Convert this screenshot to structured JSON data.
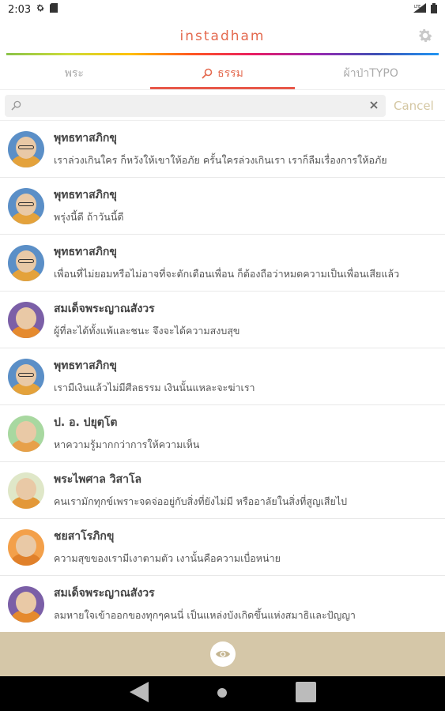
{
  "status_bar": {
    "time": "2:03",
    "network": "LTE"
  },
  "header": {
    "title": "instadham"
  },
  "tabs": [
    {
      "label": "พระ",
      "active": false
    },
    {
      "label": "ธรรม",
      "active": true
    },
    {
      "label": "ผ้าป่าTYPO",
      "active": false
    }
  ],
  "search": {
    "value": "",
    "placeholder": "",
    "cancel_label": "Cancel"
  },
  "colors": {
    "accent": "#e46a4f",
    "bottom_bar": "#d5c7a8",
    "cancel": "#d4c7a3"
  },
  "list": [
    {
      "name": "พุทธทาสภิกขุ",
      "quote": "เราล่วงเกินใคร ก็หวังให้เขาให้อภัย ครั้นใครล่วงเกินเรา เราก็ลืมเรื่องการให้อภัย",
      "avatar": "buddhadasa"
    },
    {
      "name": "พุทธทาสภิกขุ",
      "quote": "พรุ่งนี้ดี ถ้าวันนี้ดี",
      "avatar": "buddhadasa"
    },
    {
      "name": "พุทธทาสภิกขุ",
      "quote": "เพื่อนที่ไม่ยอมหรือไม่อาจที่จะตักเตือนเพื่อน ก็ต้องถือว่าหมดความเป็นเพื่อนเสียแล้ว",
      "avatar": "buddhadasa"
    },
    {
      "name": "สมเด็จพระญาณสังวร",
      "quote": "ผู้ที่ละได้ทั้งแพ้และชนะ จึงจะได้ความสงบสุข",
      "avatar": "sangharaja"
    },
    {
      "name": "พุทธทาสภิกขุ",
      "quote": "เรามีเงินแล้วไม่มีศีลธรรม เงินนั้นแหละจะฆ่าเรา",
      "avatar": "buddhadasa"
    },
    {
      "name": "ป. อ. ปยุตฺโต",
      "quote": "หาความรู้มากกว่าการให้ความเห็น",
      "avatar": "payutto"
    },
    {
      "name": "พระไพศาล วิสาโล",
      "quote": "คนเรามักทุกข์เพราะจดจ่ออยู่กับสิ่งที่ยังไม่มี หรืออาลัยในสิ่งที่สูญเสียไป",
      "avatar": "paisal"
    },
    {
      "name": "ชยสาโรภิกขุ",
      "quote": "ความสุขของเรามีเงาตามตัว เงานั้นคือความเบื่อหน่าย",
      "avatar": "jayasaro"
    },
    {
      "name": "สมเด็จพระญาณสังวร",
      "quote": "ลมหายใจเข้าออกของทุกๆคนนี่ เป็นแหล่งบังเกิดขึ้นแห่งสมาธิและปัญญา",
      "avatar": "sangharaja"
    }
  ],
  "icons": {
    "settings": "gear-icon",
    "search": "search-icon",
    "clear": "close-icon",
    "eye": "eye-icon"
  }
}
